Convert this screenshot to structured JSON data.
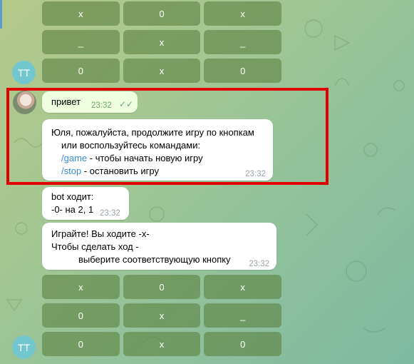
{
  "top_keyboard": [
    [
      "x",
      "0",
      "x"
    ],
    [
      "_",
      "x",
      "_"
    ],
    [
      "0",
      "x",
      "0"
    ]
  ],
  "bottom_keyboard": [
    [
      "x",
      "0",
      "x"
    ],
    [
      "0",
      "x",
      "_"
    ],
    [
      "0",
      "x",
      "0"
    ]
  ],
  "avatars": {
    "bot_initials": "TT"
  },
  "messages": {
    "user": {
      "text": "привет",
      "time": "23:32",
      "status": "✓✓"
    },
    "bot_prompt": {
      "line1": "Юля, пожалуйста, продолжите игру по кнопкам",
      "line2": "или воспользуйтесь командами:",
      "cmd1": "/game",
      "cmd1_desc": " - чтобы начать новую игру",
      "cmd2": "/stop",
      "cmd2_desc": " - остановить игру",
      "time": "23:32"
    },
    "bot_move": {
      "line1": "bot ходит:",
      "line2": "-0- на 2, 1",
      "time": "23:32"
    },
    "bot_turn": {
      "line1": "Играйте! Вы ходите -x-",
      "line2": "Чтобы сделать ход -",
      "line3": "выберите соответствующую кнопку",
      "time": "23:32"
    }
  }
}
